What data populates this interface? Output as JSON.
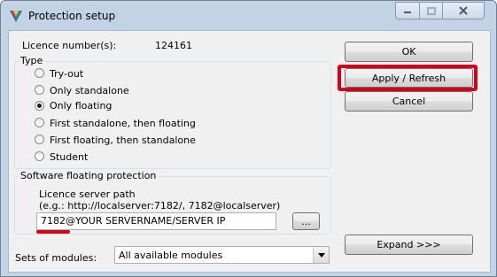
{
  "window": {
    "title": "Protection setup",
    "icon": "app-logo-icon",
    "caption_buttons": {
      "minimize": "minimize-icon",
      "maximize": "maximize-icon",
      "close": "close-icon"
    }
  },
  "licence": {
    "label": "Licence number(s):",
    "value": "124161"
  },
  "type_group": {
    "title": "Type",
    "options": [
      {
        "label": "Try-out",
        "selected": false
      },
      {
        "label": "Only standalone",
        "selected": false
      },
      {
        "label": "Only floating",
        "selected": true
      },
      {
        "label": "First standalone, then floating",
        "selected": false
      },
      {
        "label": "First floating, then standalone",
        "selected": false
      },
      {
        "label": "Student",
        "selected": false
      }
    ]
  },
  "floating_group": {
    "title": "Software floating protection",
    "server_path_label": "Licence server path",
    "server_path_example": "(e.g.: http://localserver:7182/, 7182@localserver)",
    "server_path_value": "7182@YOUR SERVERNAME/SERVER IP",
    "browse_label": "..."
  },
  "modules": {
    "label": "Sets of modules:",
    "selected": "All available modules"
  },
  "buttons": {
    "ok": "OK",
    "apply": "Apply / Refresh",
    "cancel": "Cancel",
    "expand": "Expand >>>"
  },
  "colors": {
    "annotation": "#d0021b",
    "window_frame": "#c3d3e6"
  }
}
